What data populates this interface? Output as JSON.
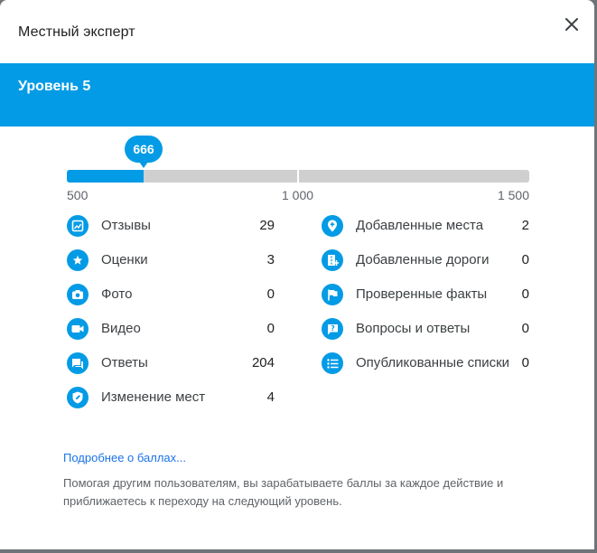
{
  "dialog": {
    "title": "Местный эксперт",
    "close_icon": "close-icon"
  },
  "level": {
    "title": "Уровень 5"
  },
  "progress": {
    "points": "666",
    "min_label": "500",
    "mid_label": "1 000",
    "max_label": "1 500",
    "min": 500,
    "max": 1500,
    "value": 666
  },
  "stats_left": [
    {
      "icon": "review-icon",
      "label": "Отзывы",
      "value": "29"
    },
    {
      "icon": "star-icon",
      "label": "Оценки",
      "value": "3"
    },
    {
      "icon": "camera-icon",
      "label": "Фото",
      "value": "0"
    },
    {
      "icon": "video-icon",
      "label": "Видео",
      "value": "0"
    },
    {
      "icon": "answers-icon",
      "label": "Ответы",
      "value": "204"
    },
    {
      "icon": "edit-place-icon",
      "label": "Изменение мест",
      "value": "4"
    }
  ],
  "stats_right": [
    {
      "icon": "add-place-icon",
      "label": "Добавленные места",
      "value": "2"
    },
    {
      "icon": "add-road-icon",
      "label": "Добавленные дороги",
      "value": "0"
    },
    {
      "icon": "flag-icon",
      "label": "Проверенные факты",
      "value": "0"
    },
    {
      "icon": "qa-icon",
      "label": "Вопросы и ответы",
      "value": "0"
    },
    {
      "icon": "list-icon",
      "label": "Опубликованные списки",
      "value": "0"
    }
  ],
  "footer": {
    "link": "Подробнее о баллах...",
    "note": "Помогая другим пользователям, вы зарабатываете баллы за каждое действие и приближаетесь к переходу на следующий уровень."
  },
  "colors": {
    "accent": "#039be5",
    "track": "#cfcfcf"
  }
}
